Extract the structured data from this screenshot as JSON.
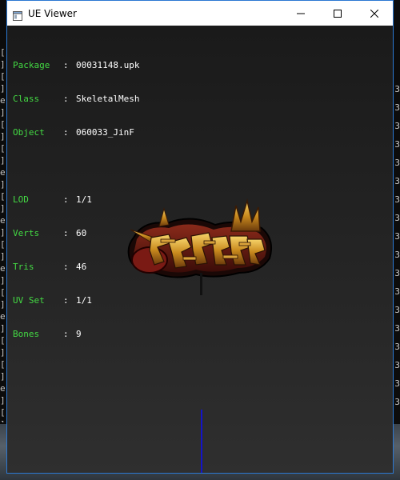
{
  "window": {
    "title": "UE Viewer",
    "buttons": {
      "minimize": "minimize-icon",
      "maximize": "maximize-icon",
      "close": "close-icon"
    }
  },
  "info": {
    "package": {
      "key": "Package",
      "value": "00031148.upk"
    },
    "class": {
      "key": "Class",
      "value": "SkeletalMesh"
    },
    "object": {
      "key": "Object",
      "value": "060033_JinF"
    },
    "lod": {
      "key": "LOD",
      "value": "1/1"
    },
    "verts": {
      "key": "Verts",
      "value": "60"
    },
    "tris": {
      "key": "Tris",
      "value": "46"
    },
    "uvset": {
      "key": "UV Set",
      "value": "1/1"
    },
    "bones": {
      "key": "Bones",
      "value": "9"
    }
  },
  "colors": {
    "label": "#43d943",
    "value": "#ffffff",
    "viewport_bg": "#262626",
    "axis": "#1414c8"
  },
  "console": {
    "left_chars": "[\n]\n[\n]\ne\n]\n[\n]\n[\n]\ne\n]\n[\n]\ne\n]\n[\n]\ne\n]\n[\n]\ne\n]\n[\n]\n[\n]\ne\n]\n[\n]\ne\n]\n[",
    "right_chars": "3\n3\n3\n3\n3\n3\n3\n3\n3\n3\n3\n3\n3\n3\n3\n3\n3\n3"
  }
}
